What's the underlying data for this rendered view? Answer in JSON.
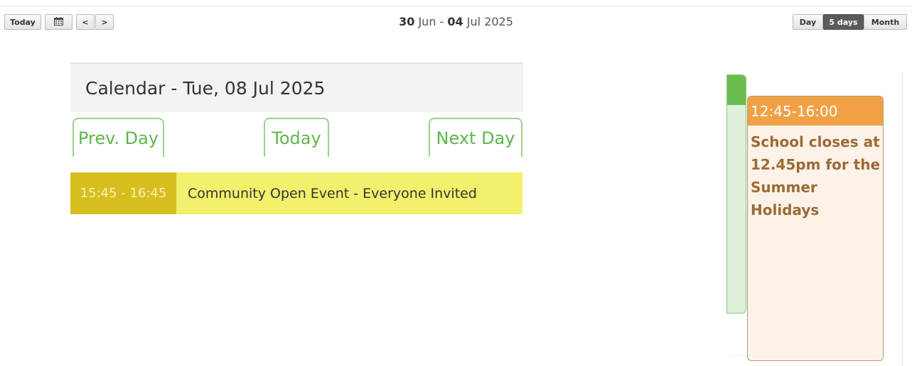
{
  "toolbar": {
    "today_label": "Today",
    "calendar_icon": "calendar-icon",
    "prev_label": "<",
    "next_label": ">",
    "range": {
      "start_day": "30",
      "start_month": "Jun",
      "separator": "-",
      "end_day": "04",
      "end_month": "Jul",
      "year": "2025"
    },
    "views": {
      "day": "Day",
      "five_days": "5 days",
      "month": "Month",
      "active": "5 days"
    }
  },
  "embedded": {
    "header_title": "Calendar - Tue, 08 Jul 2025",
    "buttons": {
      "prev_day": "Prev. Day",
      "today": "Today",
      "next_day": "Next Day"
    },
    "event": {
      "time": "15:45 - 16:45",
      "title": "Community Open Event - Everyone Invited"
    }
  },
  "events": [
    {
      "time": "12:45-16:00",
      "title": "School closes at 12.45pm for the Summer Holidays",
      "color": "#f0a146"
    }
  ],
  "colors": {
    "green_accent": "#6cbb4f",
    "yellow_event": "#f2f06c",
    "yellow_time": "#d7be1f",
    "orange_event": "#f0a146"
  }
}
